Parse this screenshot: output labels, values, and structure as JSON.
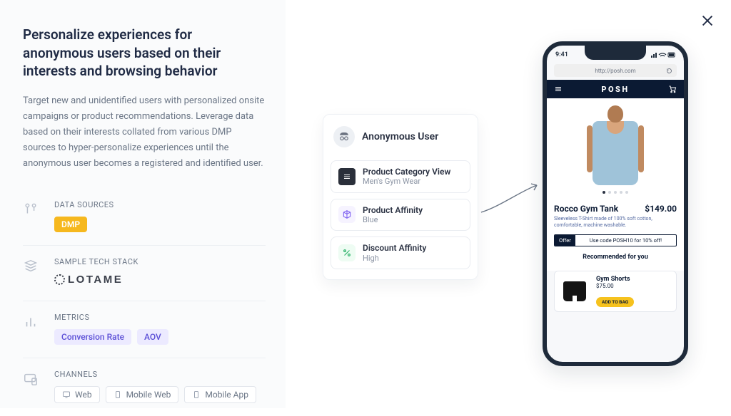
{
  "header": {
    "title": "Personalize experiences for anonymous users based on their interests and browsing behavior",
    "description": "Target new and unidentified users with personalized onsite campaigns or product recommendations. Leverage data based on their interests collated from various DMP sources to hyper-personalize experiences until the anonymous user becomes a registered and identified user."
  },
  "sections": {
    "data_sources": {
      "label": "DATA SOURCES",
      "chips": [
        "DMP"
      ]
    },
    "tech_stack": {
      "label": "SAMPLE TECH STACK",
      "logo_text": "LOTAME"
    },
    "metrics": {
      "label": "METRICS",
      "chips": [
        "Conversion Rate",
        "AOV"
      ]
    },
    "channels": {
      "label": "CHANNELS",
      "chips": [
        "Web",
        "Mobile Web",
        "Mobile App"
      ]
    }
  },
  "user_card": {
    "name": "Anonymous User",
    "items": [
      {
        "title": "Product Category View",
        "sub": "Men's Gym Wear",
        "icon": "list"
      },
      {
        "title": "Product Affinity",
        "sub": "Blue",
        "icon": "cube"
      },
      {
        "title": "Discount Affinity",
        "sub": "High",
        "icon": "percent"
      }
    ]
  },
  "phone": {
    "time": "9:41",
    "url": "http://posh.com",
    "brand": "POSH",
    "product": {
      "name": "Rocco Gym Tank",
      "price": "$149.00",
      "desc": "Sleeveless T-Shirt made of 100% soft cotton, comfortable, machine washable."
    },
    "offer_label": "Offer",
    "offer_text": "Use code POSH10 for 10% off!",
    "recommended_title": "Recommended for you",
    "rec": {
      "name": "Gym Shorts",
      "price": "$75.00",
      "cta": "ADD TO BAG"
    }
  }
}
